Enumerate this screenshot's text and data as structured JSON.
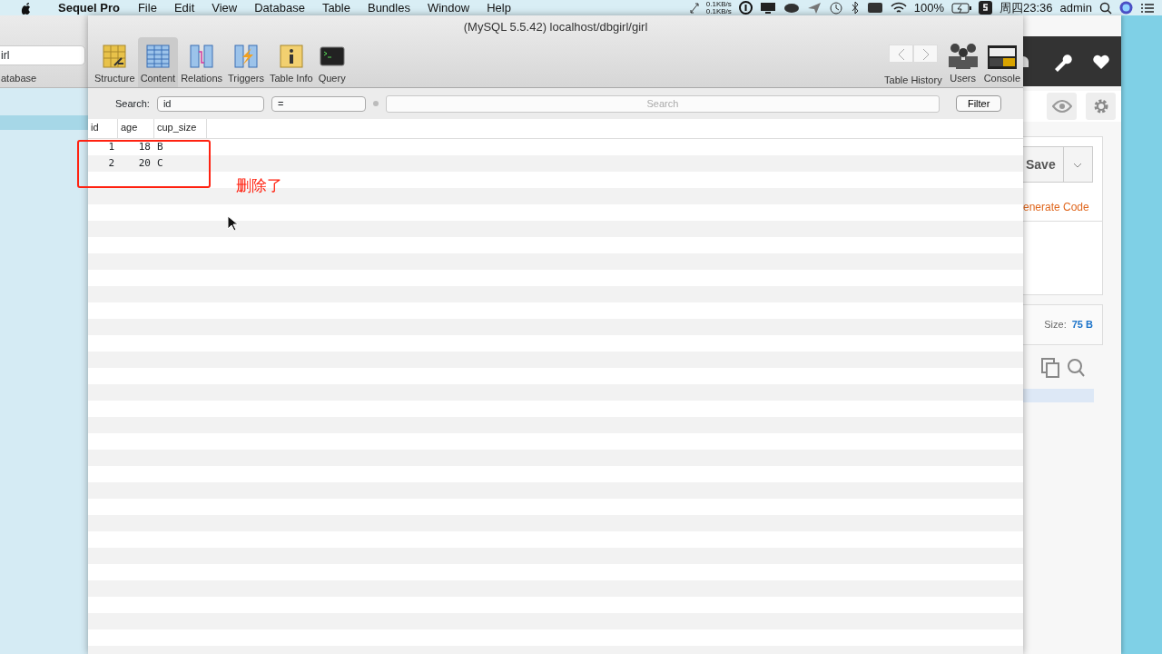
{
  "menubar": {
    "app": "Sequel Pro",
    "menus": [
      "File",
      "Edit",
      "View",
      "Database",
      "Table",
      "Bundles",
      "Window",
      "Help"
    ],
    "network": [
      "0.1KB/s",
      "0.1KB/s"
    ],
    "battery": "100%",
    "clock": "周四23:36",
    "user": "admin"
  },
  "left_window": {
    "database_select": "irl",
    "label": "atabase"
  },
  "window": {
    "title": "(MySQL 5.5.42) localhost/dbgirl/girl",
    "toolbar": [
      {
        "label": "Structure",
        "selected": false
      },
      {
        "label": "Content",
        "selected": true
      },
      {
        "label": "Relations",
        "selected": false
      },
      {
        "label": "Triggers",
        "selected": false
      },
      {
        "label": "Table Info",
        "selected": false
      },
      {
        "label": "Query",
        "selected": false
      }
    ],
    "history_label": "Table History",
    "users_label": "Users",
    "console_label": "Console"
  },
  "filter": {
    "label": "Search:",
    "field": "id",
    "operator": "=",
    "placeholder": "Search",
    "button": "Filter"
  },
  "table": {
    "columns": [
      "id",
      "age",
      "cup_size"
    ],
    "rows": [
      [
        "1",
        "18",
        "B"
      ],
      [
        "2",
        "20",
        "C"
      ]
    ]
  },
  "annotation": {
    "text": "删除了"
  },
  "right_window": {
    "save": "Save",
    "link": "enerate Code",
    "size_label": "Size:",
    "size_value": "75 B"
  }
}
